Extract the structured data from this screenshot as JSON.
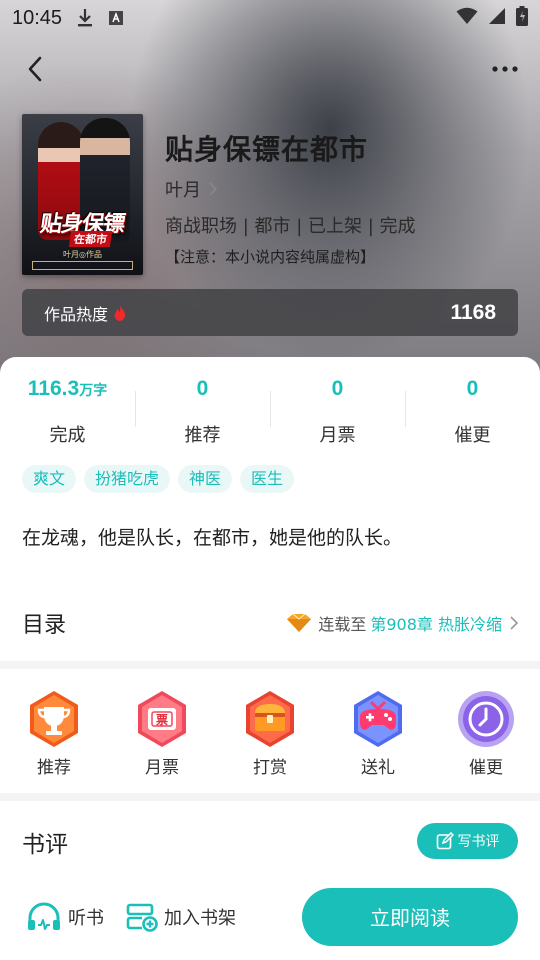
{
  "status_bar": {
    "time": "10:45"
  },
  "book": {
    "title": "贴身保镖在都市",
    "author": "叶月",
    "meta": "商战职场 | 都市 | 已上架 | 完成",
    "notice": "【注意：本小说内容纯属虚构】",
    "cover": {
      "title": "贴身保镖",
      "subtitle": "在都市",
      "author_line": "叶月◎作品"
    }
  },
  "heat": {
    "label": "作品热度",
    "value": "1168"
  },
  "stats": [
    {
      "value": "116.3",
      "unit": "万字",
      "label": "完成"
    },
    {
      "value": "0",
      "unit": "",
      "label": "推荐"
    },
    {
      "value": "0",
      "unit": "",
      "label": "月票"
    },
    {
      "value": "0",
      "unit": "",
      "label": "催更"
    }
  ],
  "tags": [
    "爽文",
    "扮猪吃虎",
    "神医",
    "医生"
  ],
  "description": "在龙魂，他是队长，在都市，她是他的队长。",
  "toc": {
    "title": "目录",
    "prefix": "连载至",
    "latest_chapter": "第908章 热胀冷缩"
  },
  "actions": [
    {
      "label": "推荐",
      "icon": "trophy-icon"
    },
    {
      "label": "月票",
      "icon": "ticket-icon"
    },
    {
      "label": "打赏",
      "icon": "treasure-chest-icon"
    },
    {
      "label": "送礼",
      "icon": "gamepad-gift-icon"
    },
    {
      "label": "催更",
      "icon": "clock-icon"
    }
  ],
  "reviews": {
    "title": "书评",
    "write_label": "写书评"
  },
  "bottom_bar": {
    "listen_label": "听书",
    "add_shelf_label": "加入书架",
    "read_label": "立即阅读"
  },
  "colors": {
    "accent": "#1bbfb9",
    "accent_light": "#eaf7f7"
  }
}
